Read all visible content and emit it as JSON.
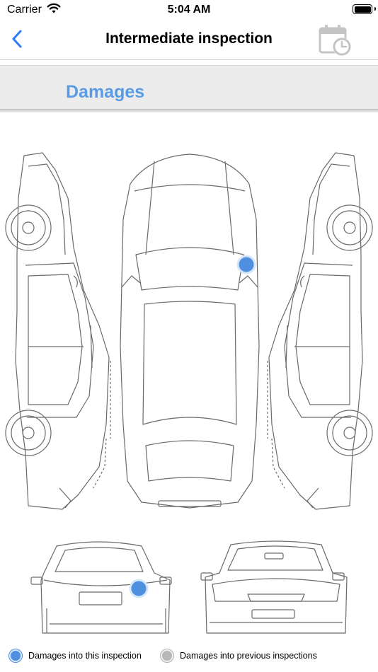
{
  "status_bar": {
    "carrier": "Carrier",
    "time": "5:04 AM"
  },
  "nav": {
    "title": "Intermediate inspection"
  },
  "section": {
    "title": "Damages"
  },
  "legend": {
    "current_label": "Damages into this inspection",
    "previous_label": "Damages into previous inspections",
    "current_color": "#4f8fe0",
    "previous_color": "#b8b8b8"
  },
  "icons": [
    "wifi-icon",
    "battery-icon",
    "back-chevron-icon",
    "calendar-clock-icon",
    "damage-marker-icon"
  ]
}
